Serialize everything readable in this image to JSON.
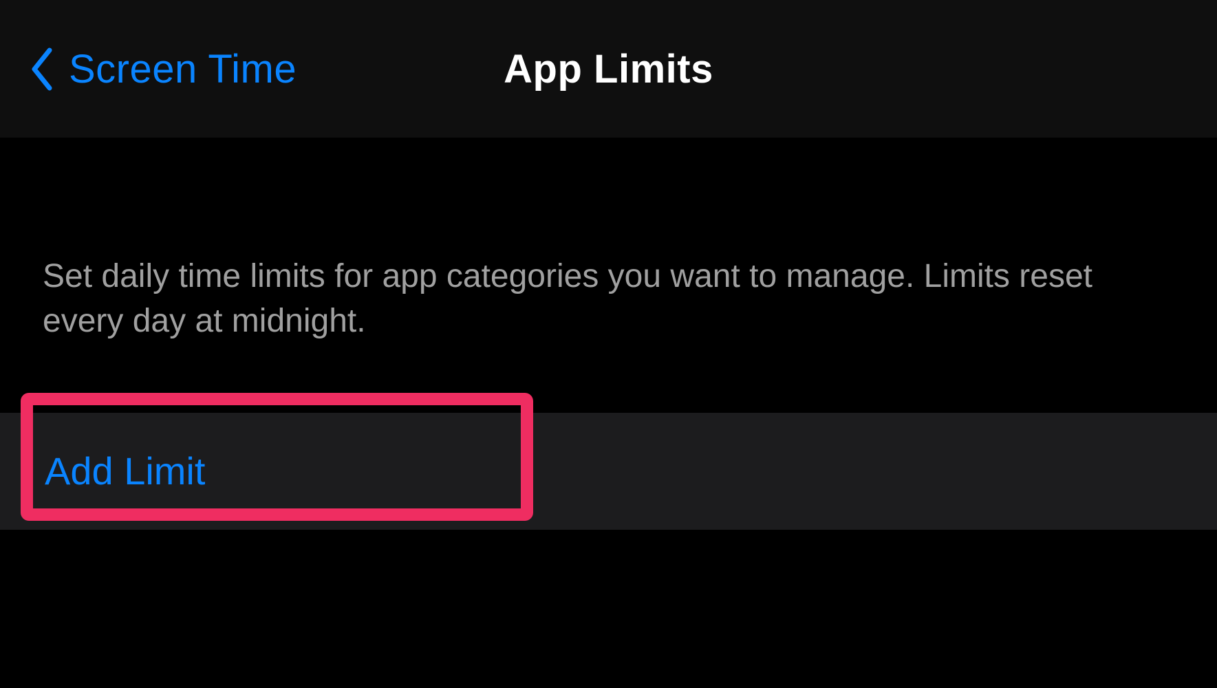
{
  "nav": {
    "back_label": "Screen Time",
    "title": "App Limits"
  },
  "description": "Set daily time limits for app categories you want to manage. Limits reset every day at midnight.",
  "actions": {
    "add_limit_label": "Add Limit"
  }
}
